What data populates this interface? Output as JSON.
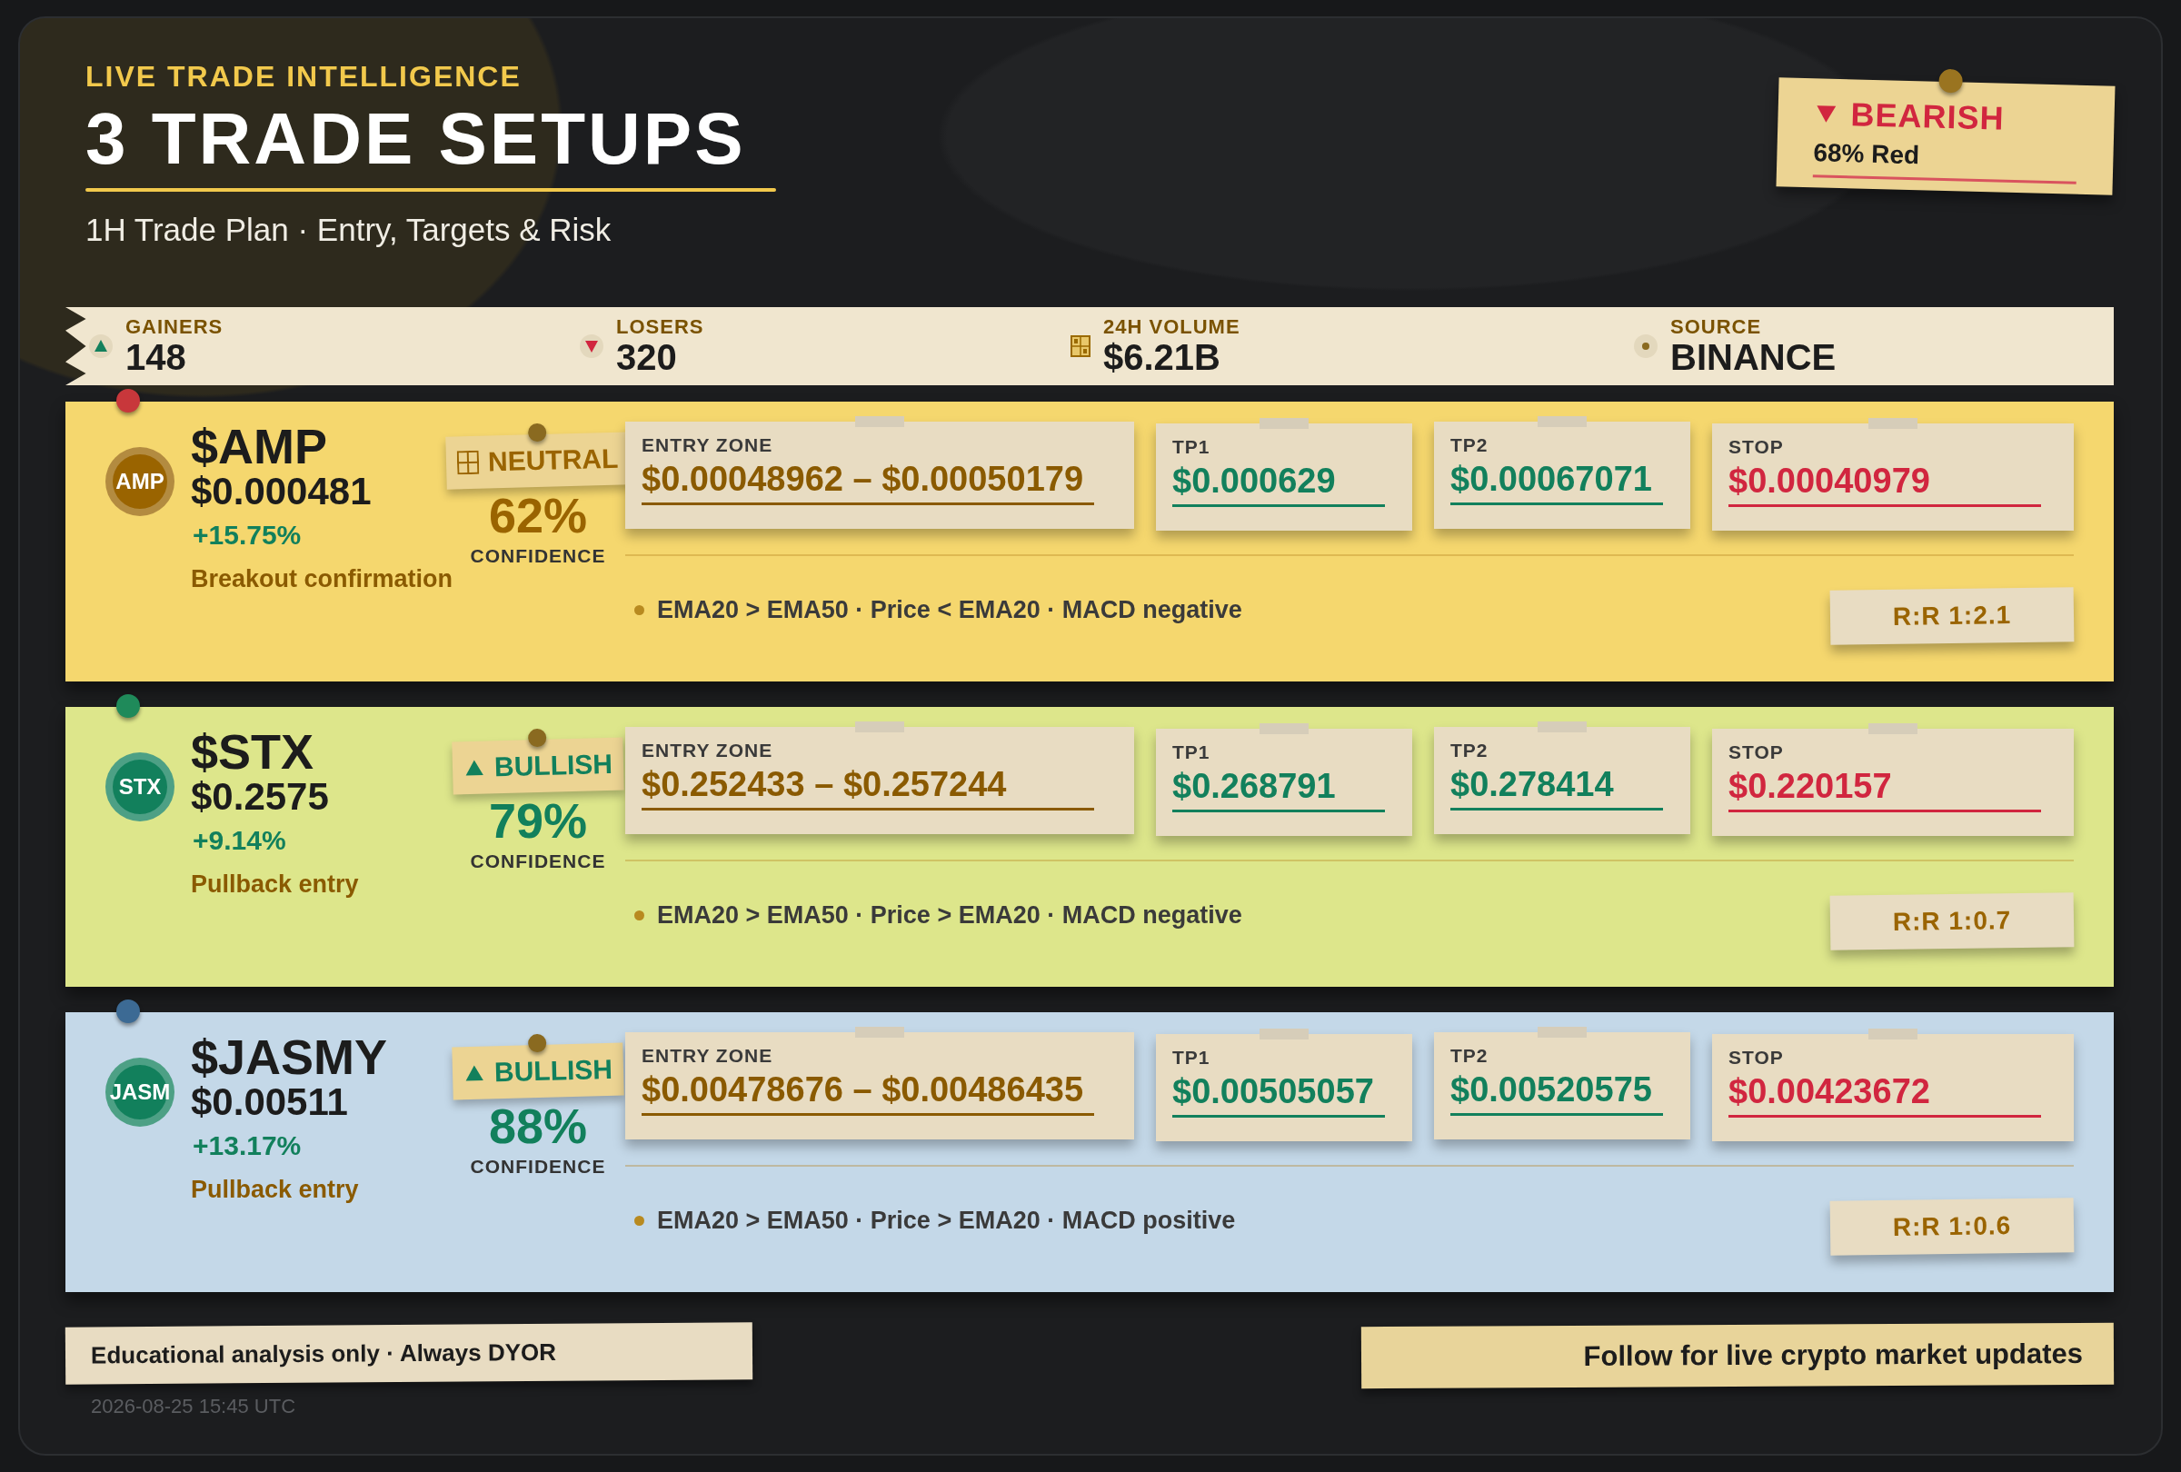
{
  "header": {
    "eyebrow": "LIVE TRADE INTELLIGENCE",
    "title": "3 TRADE SETUPS",
    "subtitle": "1H Trade Plan · Entry, Targets & Risk"
  },
  "sentiment": {
    "kind": "down",
    "label": "BEARISH",
    "detail": "68% Red"
  },
  "stats": [
    {
      "kind": "up",
      "label": "GAINERS",
      "value": "148"
    },
    {
      "kind": "down",
      "label": "LOSERS",
      "value": "320"
    },
    {
      "kind": "volume",
      "label": "24H VOLUME",
      "value": "$6.21B"
    },
    {
      "kind": "source",
      "label": "SOURCE",
      "value": "BINANCE"
    }
  ],
  "setups": [
    {
      "color": "#f5d76e",
      "pin": {
        "color": "#c8373b"
      },
      "badge": "AMP",
      "symbol": "$AMP",
      "price": "$0.000481",
      "change": "+15.75%",
      "note": "Breakout confirmation",
      "bias": {
        "kind": "neutral",
        "label": "NEUTRAL"
      },
      "confidence": "62%",
      "confidence_label": "CONFIDENCE",
      "levels": [
        {
          "kind": "entry",
          "label": "ENTRY ZONE",
          "value": "$0.00048962 – $0.00050179"
        },
        {
          "kind": "target",
          "label": "TP1",
          "value": "$0.000629"
        },
        {
          "kind": "target",
          "label": "TP2",
          "value": "$0.00067071"
        },
        {
          "kind": "stop",
          "label": "STOP",
          "value": "$0.00040979"
        }
      ],
      "indicators": "EMA20 > EMA50 · Price < EMA20 · MACD negative",
      "rr": "R:R 1:2.1"
    },
    {
      "color": "#dde68b",
      "pin": {
        "color": "#1f8a5a"
      },
      "badge": "STX",
      "symbol": "$STX",
      "price": "$0.2575",
      "change": "+9.14%",
      "note": "Pullback entry",
      "bias": {
        "kind": "bullish",
        "label": "BULLISH"
      },
      "confidence": "79%",
      "confidence_label": "CONFIDENCE",
      "levels": [
        {
          "kind": "entry",
          "label": "ENTRY ZONE",
          "value": "$0.252433 – $0.257244"
        },
        {
          "kind": "target",
          "label": "TP1",
          "value": "$0.268791"
        },
        {
          "kind": "target",
          "label": "TP2",
          "value": "$0.278414"
        },
        {
          "kind": "stop",
          "label": "STOP",
          "value": "$0.220157"
        }
      ],
      "indicators": "EMA20 > EMA50 · Price > EMA20 · MACD negative",
      "rr": "R:R 1:0.7"
    },
    {
      "color": "#c4d8e8",
      "pin": {
        "color": "#3c6a94"
      },
      "badge": "JASM",
      "symbol": "$JASMY",
      "price": "$0.00511",
      "change": "+13.17%",
      "note": "Pullback entry",
      "bias": {
        "kind": "bullish",
        "label": "BULLISH"
      },
      "confidence": "88%",
      "confidence_label": "CONFIDENCE",
      "levels": [
        {
          "kind": "entry",
          "label": "ENTRY ZONE",
          "value": "$0.00478676 – $0.00486435"
        },
        {
          "kind": "target",
          "label": "TP1",
          "value": "$0.00505057"
        },
        {
          "kind": "target",
          "label": "TP2",
          "value": "$0.00520575"
        },
        {
          "kind": "stop",
          "label": "STOP",
          "value": "$0.00423672"
        }
      ],
      "indicators": "EMA20 > EMA50 · Price > EMA20 · MACD positive",
      "rr": "R:R 1:0.6"
    }
  ],
  "footer": {
    "disclaimer": "Educational analysis only · Always DYOR",
    "timestamp": "2026-08-25 15:45 UTC",
    "cta": "Follow for live crypto market updates"
  }
}
